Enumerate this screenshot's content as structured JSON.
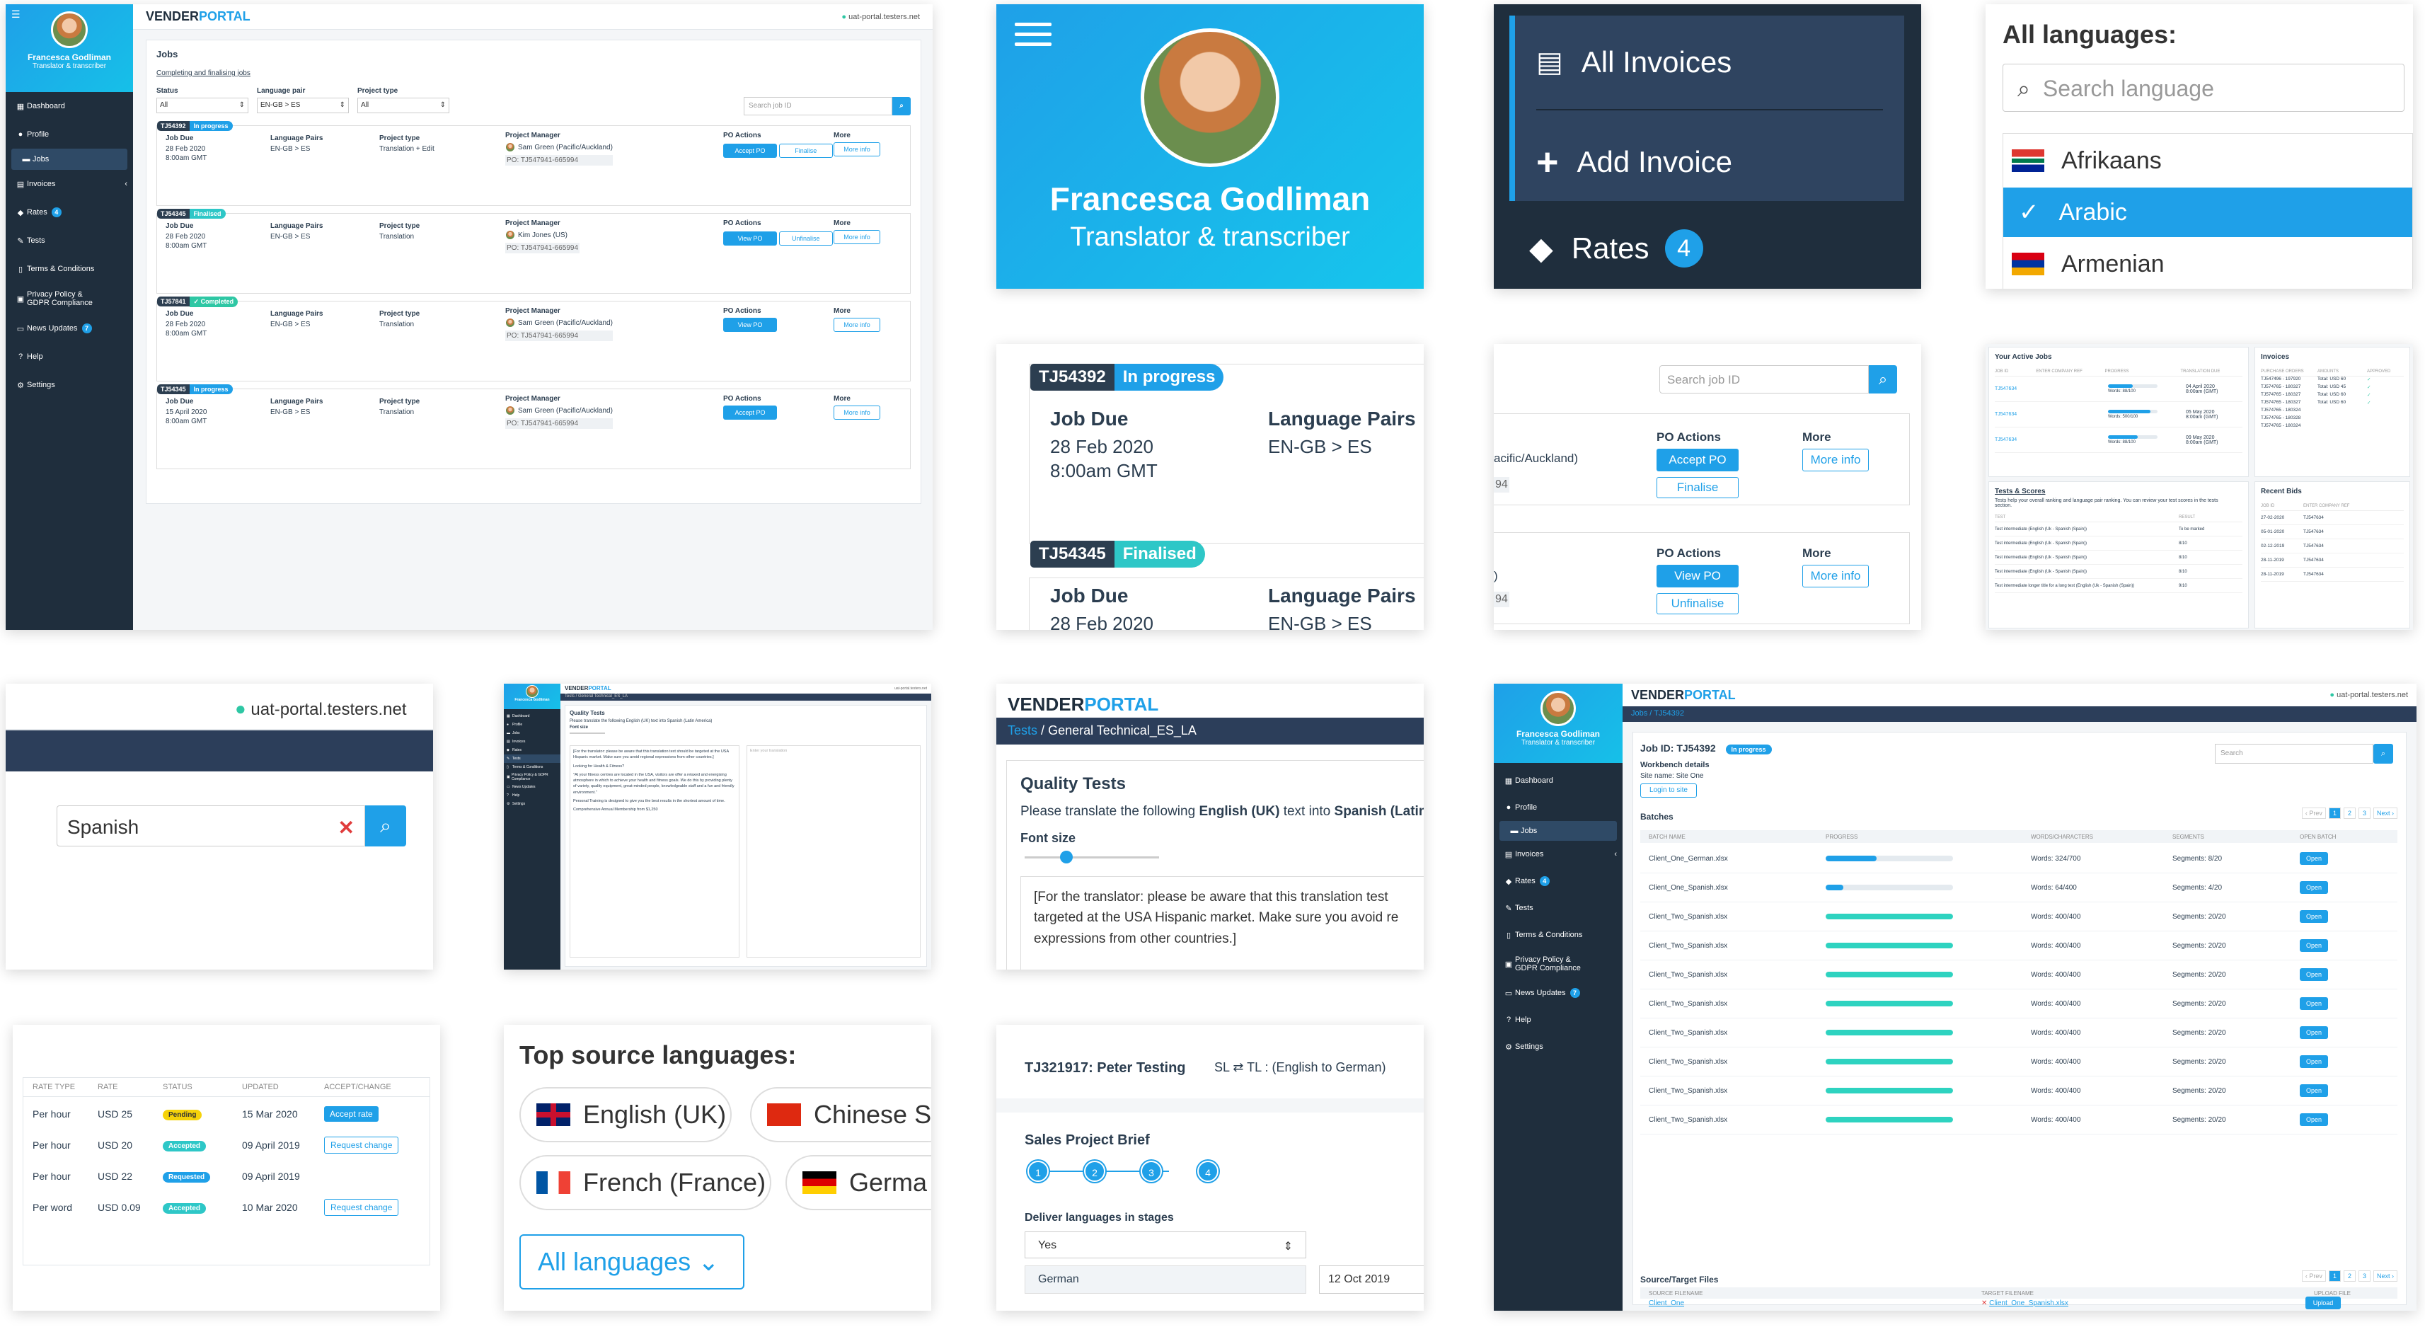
{
  "brand": {
    "vender": "VENDER",
    "portal": "PORTAL",
    "url": "uat-portal.testers.net"
  },
  "user": {
    "name": "Francesca Godliman",
    "role": "Translator & transcriber"
  },
  "nav": {
    "dashboard": "Dashboard",
    "profile": "Profile",
    "jobs": "Jobs",
    "invoices": "Invoices",
    "rates": "Rates",
    "rates_badge": "4",
    "tests": "Tests",
    "terms": "Terms & Conditions",
    "privacy1": "Privacy Policy &",
    "privacy2": "GDPR Compliance",
    "news": "News Updates",
    "news_badge": "7",
    "help": "Help",
    "settings": "Settings"
  },
  "jobs": {
    "title": "Jobs",
    "link": "Completing and finalising jobs",
    "filters": {
      "status_label": "Status",
      "status_value": "All",
      "pair_label": "Language pair",
      "pair_value": "EN-GB > ES",
      "type_label": "Project type",
      "type_value": "All",
      "search_placeholder": "Search job ID"
    },
    "headers": {
      "due": "Job Due",
      "pairs": "Language Pairs",
      "type": "Project type",
      "pm": "Project Manager",
      "po": "PO Actions",
      "more": "More"
    },
    "more_info": "More info",
    "rows": [
      {
        "id": "TJ54392",
        "status": "In progress",
        "date": "28 Feb 2020",
        "time": "8:00am GMT",
        "pair": "EN-GB > ES",
        "type": "Translation + Edit",
        "pm": "Sam Green (Pacific/Auckland)",
        "po": "PO: TJ547941-665994",
        "btn1": "Accept PO",
        "btn2": "Finalise"
      },
      {
        "id": "TJ54345",
        "status": "Finalised",
        "date": "28 Feb 2020",
        "time": "8:00am GMT",
        "pair": "EN-GB > ES",
        "type": "Translation",
        "pm": "Kim Jones (US)",
        "po": "PO: TJ547941-665994",
        "btn1": "View PO",
        "btn2": "Unfinalise"
      },
      {
        "id": "TJ57841",
        "status": "✓ Completed",
        "date": "28 Feb 2020",
        "time": "8:00am GMT",
        "pair": "EN-GB > ES",
        "type": "Translation",
        "pm": "Sam Green (Pacific/Auckland)",
        "po": "PO: TJ547941-665994",
        "btn1": "View PO",
        "btn2": ""
      },
      {
        "id": "TJ54345",
        "status": "In progress",
        "date": "15 April 2020",
        "time": "8:00am GMT",
        "pair": "EN-GB > ES",
        "type": "Translation",
        "pm": "Sam Green (Pacific/Auckland)",
        "po": "PO: TJ547941-665994",
        "btn1": "Accept PO",
        "btn2": ""
      }
    ]
  },
  "menu_zoom": {
    "all_invoices": "All Invoices",
    "add_invoice": "Add Invoice",
    "rates": "Rates",
    "rates_badge": "4"
  },
  "lang_panel": {
    "title": "All languages:",
    "placeholder": "Search language",
    "items": [
      "Afrikaans",
      "Arabic",
      "Armenian"
    ]
  },
  "zoom_job": {
    "row1_id": "TJ54392",
    "row1_status": "In progress",
    "row2_id": "TJ54345",
    "row2_status": "Finalised",
    "due": "Job Due",
    "pairs": "Language Pairs",
    "date": "28 Feb 2020",
    "time": "8:00am GMT",
    "pair": "EN-GB > ES"
  },
  "zoom_po": {
    "search_placeholder": "Search job ID",
    "pm_partial": "acific/Auckland)",
    "po_partial1": "94",
    "po_partial2": "94",
    "paren": ")",
    "po": "PO Actions",
    "more": "More",
    "accept": "Accept PO",
    "finalise": "Finalise",
    "view": "View PO",
    "unfinalise": "Unfinalise",
    "more_info": "More info"
  },
  "dashboard": {
    "active_title": "Your Active Jobs",
    "active_headers": [
      "JOB ID",
      "ENTER COMPANY REF",
      "PROGRESS",
      "TRANSLATION DUE"
    ],
    "active_rows": [
      {
        "id": "TJ547634",
        "words": "Words: 88/100",
        "date": "04 April 2020",
        "time": "8:00am (GMT)",
        "p": 0.5
      },
      {
        "id": "TJ547634",
        "words": "Words: 500/100",
        "date": "05 May 2020",
        "time": "8:00am (GMT)",
        "p": 0.85
      },
      {
        "id": "TJ547634",
        "words": "Words: 88/100",
        "date": "09 May 2020",
        "time": "8:00am (GMT)",
        "p": 0.6
      }
    ],
    "invoices_title": "Invoices",
    "invoices_headers": [
      "PURCHASE ORDERS",
      "AMOUNTS",
      "APPROVED"
    ],
    "invoices_rows": [
      {
        "po": "TJ547496 - 197920",
        "amt": "Total: USD 60"
      },
      {
        "po": "TJ574765 - 180327",
        "amt": "Total: USD 45"
      },
      {
        "po": "TJ574765 - 180327",
        "amt": "Total: USD 60"
      },
      {
        "po": "TJ574765 - 180327",
        "amt": "Total: USD 60"
      },
      {
        "po": "TJ574765 - 180324",
        "amt": ""
      },
      {
        "po": "TJ574765 - 180328",
        "amt": ""
      },
      {
        "po": "TJ574765 - 180324",
        "amt": ""
      }
    ],
    "tests_title": "Tests & Scores",
    "tests_desc": "Tests help your overall ranking and language pair ranking. You can review your test scores in the tests section.",
    "tests_headers": [
      "TEST",
      "RESULT"
    ],
    "tests_rows": [
      {
        "t": "Test intermediate (English (Uk - Spanish (Spain))",
        "r": "To be marked"
      },
      {
        "t": "Test intermediate (English (Uk - Spanish (Spain))",
        "r": "8/10"
      },
      {
        "t": "Test intermediate (English (Uk - Spanish (Spain))",
        "r": "8/10"
      },
      {
        "t": "Test intermediate (English (Uk - Spanish (Spain))",
        "r": "8/10"
      },
      {
        "t": "Test intermediate longer title for a long test (English (Uk - Spanish (Spain))",
        "r": "9/10"
      }
    ],
    "bids_title": "Recent Bids",
    "bids_headers": [
      "JOB ID",
      "ENTER COMPANY REF"
    ],
    "bids_rows": [
      {
        "d": "27-02-2020",
        "id": "TJ547634"
      },
      {
        "d": "05-01-2020",
        "id": "TJ547634"
      },
      {
        "d": "02-12-2019",
        "id": "TJ547634"
      },
      {
        "d": "28-11-2019",
        "id": "TJ547634"
      },
      {
        "d": "28-11-2019",
        "id": "TJ547634"
      }
    ]
  },
  "url_zoom": {
    "url": "uat-portal.testers.net",
    "search_value": "Spanish"
  },
  "quality_mini": {
    "breadcrumb": "Tests / General Technical_ES_LA",
    "title": "Quality Tests",
    "intro": "Please translate the following English (UK) text into Spanish (Latin America)",
    "font": "Font size",
    "placeholder": "Enter your translation",
    "p1": "[For the translator: please be aware that this translation text should be targeted at the USA Hispanic market. Make sure you avoid regional expressions from other countries.]",
    "p2": "Looking for Health & Fitness?",
    "p3": "\"At your fitness centres are located in the USA, visitors are offer a relaxed and energising atmosphere in which to achieve your health and fitness goals. We do this by providing plenty of variety, quality equipment, great-minded people, knowledgeable staff and a fun and friendly environment.\"",
    "p4": "Personal Training is designed to give you the best results in the shortest amount of time.",
    "p5": "Comprehensive Annual Membership from $1,250"
  },
  "quality_zoom": {
    "tests": "Tests",
    "sep": "/",
    "crumb": "General Technical_ES_LA",
    "title": "Quality Tests",
    "intro_a": "Please translate the following ",
    "intro_b": "English (UK)",
    "intro_c": " text into ",
    "intro_d": "Spanish (Latin A",
    "font": "Font size",
    "text": "[For the translator: please be aware that this translation test targeted at the USA Hispanic market. Make sure you avoid re expressions from other countries.]"
  },
  "rates_table": {
    "headers": [
      "RATE TYPE",
      "RATE",
      "STATUS",
      "UPDATED",
      "ACCEPT/CHANGE"
    ],
    "rows": [
      {
        "type": "Per hour",
        "rate": "USD 25",
        "status": "Pending",
        "updated": "15 Mar 2020",
        "action": "Accept rate",
        "color": "#f5d20a"
      },
      {
        "type": "Per hour",
        "rate": "USD 20",
        "status": "Accepted",
        "updated": "09 April 2019",
        "action": "Request change",
        "color": "#2ec7c7"
      },
      {
        "type": "Per hour",
        "rate": "USD 22",
        "status": "Requested",
        "updated": "09 April 2019",
        "action": "",
        "color": "#1fa0e8"
      },
      {
        "type": "Per word",
        "rate": "USD 0.09",
        "status": "Accepted",
        "updated": "10 Mar 2020",
        "action": "Request change",
        "color": "#2ec7c7"
      }
    ]
  },
  "top_langs": {
    "title": "Top source languages:",
    "langs": [
      "English (UK)",
      "Chinese S",
      "French (France)",
      "Germa"
    ],
    "all": "All languages"
  },
  "brief": {
    "title": "TJ321917: Peter Testing",
    "sl": "SL ⇄ TL : (English to German)",
    "section": "Sales Project Brief",
    "steps": [
      "1",
      "2",
      "3",
      "4"
    ],
    "deliver": "Deliver languages in stages",
    "yes": "Yes",
    "german": "German",
    "date": "12 Oct 2019"
  },
  "batches": {
    "breadcrumb": "Jobs / TJ54392",
    "jobid": "Job ID: TJ54392",
    "status": "In progress",
    "wb": "Workbench details",
    "site": "Site name: Site One",
    "login": "Login to site",
    "search": "Search",
    "title": "Batches",
    "prev": "‹ Prev",
    "next": "Next ›",
    "pages": [
      "1",
      "2",
      "3"
    ],
    "headers": [
      "BATCH NAME",
      "PROGRESS",
      "WORDS/CHARACTERS",
      "SEGMENTS",
      "OPEN BATCH"
    ],
    "open": "Open",
    "rows": [
      {
        "n": "Client_One_German.xlsx",
        "w": "Words: 324/700",
        "s": "Segments: 8/20",
        "p": 0.4,
        "c": "#1fa0e8"
      },
      {
        "n": "Client_One_Spanish.xlsx",
        "w": "Words: 64/400",
        "s": "Segments: 4/20",
        "p": 0.14,
        "c": "#1fa0e8"
      },
      {
        "n": "Client_Two_Spanish.xlsx",
        "w": "Words: 400/400",
        "s": "Segments: 20/20",
        "p": 1,
        "c": "#2ed3c0"
      },
      {
        "n": "Client_Two_Spanish.xlsx",
        "w": "Words: 400/400",
        "s": "Segments: 20/20",
        "p": 1,
        "c": "#2ed3c0"
      },
      {
        "n": "Client_Two_Spanish.xlsx",
        "w": "Words: 400/400",
        "s": "Segments: 20/20",
        "p": 1,
        "c": "#2ed3c0"
      },
      {
        "n": "Client_Two_Spanish.xlsx",
        "w": "Words: 400/400",
        "s": "Segments: 20/20",
        "p": 1,
        "c": "#2ed3c0"
      },
      {
        "n": "Client_Two_Spanish.xlsx",
        "w": "Words: 400/400",
        "s": "Segments: 20/20",
        "p": 1,
        "c": "#2ed3c0"
      },
      {
        "n": "Client_Two_Spanish.xlsx",
        "w": "Words: 400/400",
        "s": "Segments: 20/20",
        "p": 1,
        "c": "#2ed3c0"
      },
      {
        "n": "Client_Two_Spanish.xlsx",
        "w": "Words: 400/400",
        "s": "Segments: 20/20",
        "p": 1,
        "c": "#2ed3c0"
      },
      {
        "n": "Client_Two_Spanish.xlsx",
        "w": "Words: 400/400",
        "s": "Segments: 20/20",
        "p": 1,
        "c": "#2ed3c0"
      }
    ],
    "files_title": "Source/Target Files",
    "files_headers": [
      "SOURCE FILENAME",
      "TARGET FILENAME",
      "UPLOAD FILE"
    ],
    "file_src": "Client_One",
    "file_tgt": "Client_One_Spanish.xlsx",
    "upload": "Upload"
  }
}
